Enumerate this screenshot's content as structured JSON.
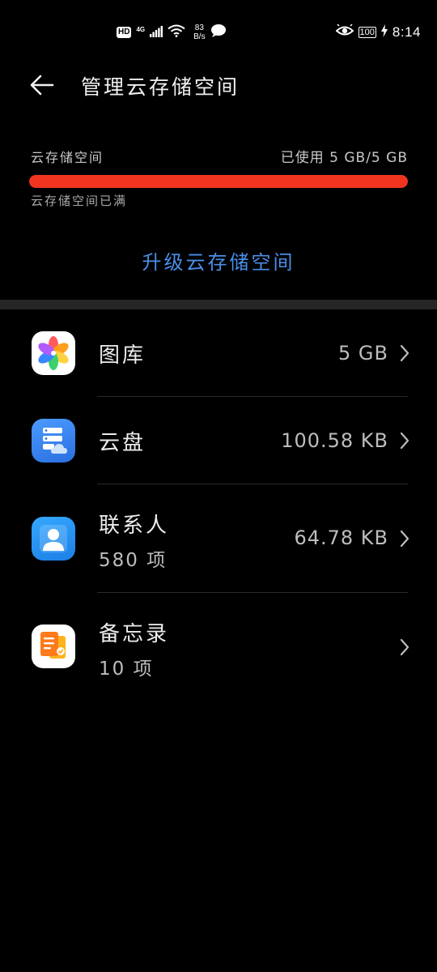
{
  "status_bar": {
    "hd": "HD",
    "network": "4G",
    "speed_value": "83",
    "speed_unit": "B/s",
    "battery": "100",
    "time": "8:14"
  },
  "header": {
    "title": "管理云存储空间"
  },
  "storage": {
    "label": "云存储空间",
    "used_text": "已使用 5 GB/5 GB",
    "used_fraction": 1.0,
    "full_message": "云存储空间已满",
    "bar_color": "#f0341f"
  },
  "upgrade": {
    "label": "升级云存储空间",
    "color": "#4a8ee8"
  },
  "items": [
    {
      "icon": "gallery-icon",
      "title": "图库",
      "subtitle": "",
      "value": "5 GB"
    },
    {
      "icon": "cloud-drive-icon",
      "title": "云盘",
      "subtitle": "",
      "value": "100.58 KB"
    },
    {
      "icon": "contacts-icon",
      "title": "联系人",
      "subtitle": "580 项",
      "value": "64.78 KB"
    },
    {
      "icon": "notes-icon",
      "title": "备忘录",
      "subtitle": "10 项",
      "value": ""
    }
  ]
}
